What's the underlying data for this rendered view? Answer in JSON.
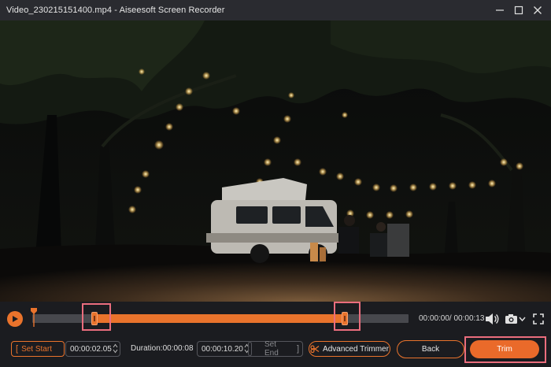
{
  "window": {
    "title": "Video_230215151400.mp4  -  Aiseesoft Screen Recorder"
  },
  "player": {
    "time_readout": "00:00:00/ 00:00:13",
    "selection_start_fraction": 0.16,
    "selection_end_fraction": 0.83
  },
  "trim": {
    "set_start_label": "Set Start",
    "start_time": "00:00:02.05",
    "duration_label": "Duration:00:00:08",
    "end_time": "00:00:10.20",
    "set_end_label": "Set End",
    "advanced_trimmer_label": "Advanced Trimmer",
    "back_label": "Back",
    "trim_label": "Trim"
  },
  "colors": {
    "accent": "#e9732c",
    "highlight": "#ea6d7d"
  }
}
